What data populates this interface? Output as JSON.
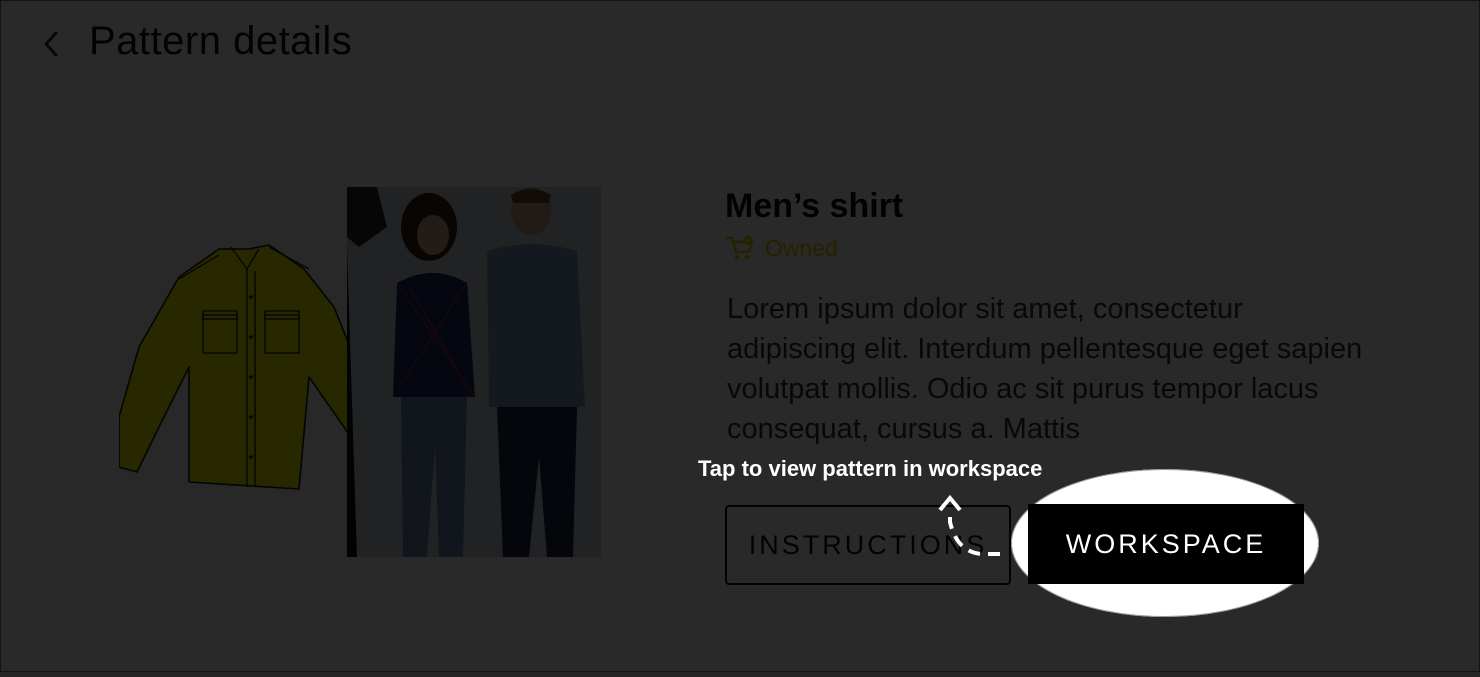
{
  "header": {
    "title": "Pattern details",
    "back_icon": "chevron-left-icon"
  },
  "product": {
    "name": "Men’s shirt",
    "status_icon": "cart-check-icon",
    "status_label": "Owned",
    "status_color": "#e7c400",
    "description": "Lorem ipsum dolor sit amet, consectetur adipiscing elit. Interdum pellentesque eget sapien volutpat mollis. Odio ac sit purus tempor lacus consequat, cursus a. Mattis"
  },
  "actions": {
    "instructions_label": "INSTRUCTIONS",
    "workspace_label": "WORKSPACE"
  },
  "coachmark": {
    "text": "Tap to view pattern in workspace",
    "arrow_icon": "dashed-curved-arrow-icon"
  }
}
